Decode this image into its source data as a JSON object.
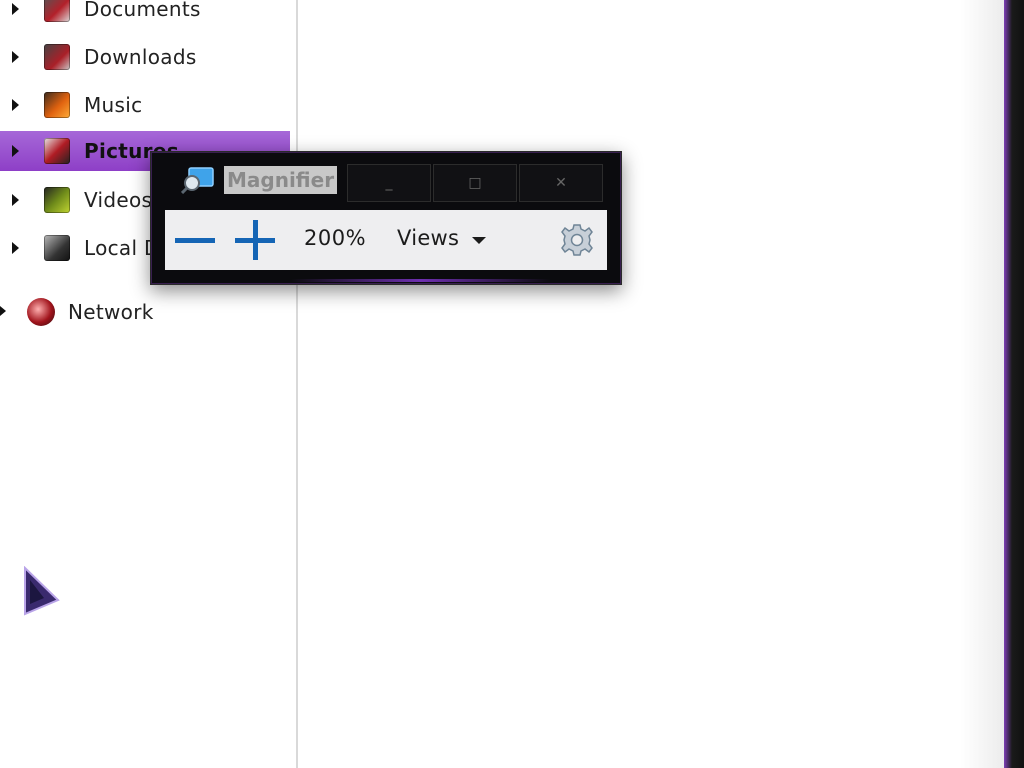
{
  "nav_pane": {
    "items": [
      {
        "label": "Documents",
        "icon": "documents-folder-icon",
        "selected": false
      },
      {
        "label": "Downloads",
        "icon": "downloads-folder-icon",
        "selected": false
      },
      {
        "label": "Music",
        "icon": "music-folder-icon",
        "selected": false
      },
      {
        "label": "Pictures",
        "icon": "pictures-folder-icon",
        "selected": true
      },
      {
        "label": "Videos",
        "icon": "videos-folder-icon",
        "selected": false
      },
      {
        "label": "Local Disk",
        "icon": "local-disk-icon",
        "selected": false
      }
    ],
    "network": {
      "label": "Network",
      "icon": "network-globe-icon"
    }
  },
  "magnifier": {
    "title": "Magnifier",
    "caption_buttons": {
      "minimize": "_",
      "maximize": "□",
      "close": "✕"
    },
    "toolbar": {
      "zoom_out_icon": "minus-icon",
      "zoom_in_icon": "plus-icon",
      "zoom_level": "200%",
      "views_label": "Views",
      "settings_icon": "gear-icon"
    }
  },
  "colors": {
    "selection": "#9b52d2",
    "accent_blue": "#1565b5",
    "window_frame": "#0b0b0e"
  }
}
